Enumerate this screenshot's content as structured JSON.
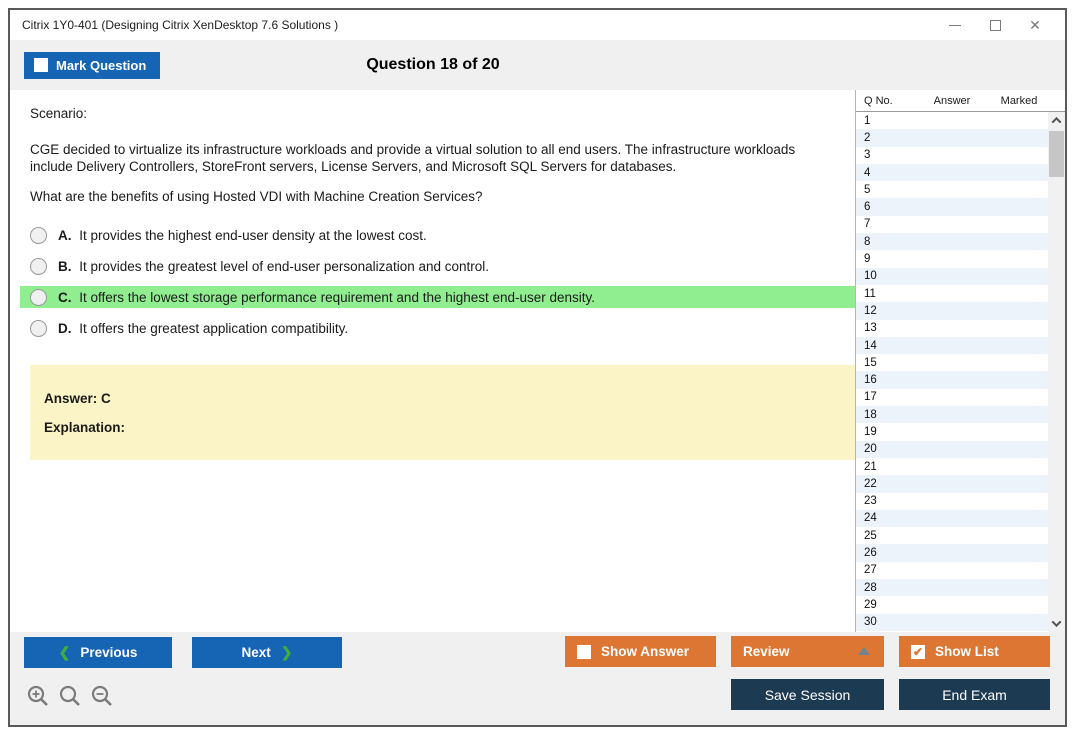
{
  "window": {
    "title": "Citrix 1Y0-401 (Designing Citrix XenDesktop 7.6 Solutions )",
    "close_glyph": "✕"
  },
  "header": {
    "mark_question_label": "Mark Question",
    "question_counter": "Question 18 of 20"
  },
  "question": {
    "scenario_label": "Scenario:",
    "scenario_text": "CGE decided to virtualize its infrastructure workloads and provide a virtual solution to all end users. The infrastructure workloads include Delivery Controllers, StoreFront servers, License Servers, and Microsoft SQL Servers for databases.",
    "prompt": "What are the benefits of using Hosted VDI with Machine Creation Services?",
    "options": [
      {
        "letter": "A.",
        "text": "It provides the highest end-user density at the lowest cost.",
        "highlighted": false
      },
      {
        "letter": "B.",
        "text": "It provides the greatest level of end-user personalization and control.",
        "highlighted": false
      },
      {
        "letter": "C.",
        "text": "It offers the lowest storage performance requirement and the highest end-user density.",
        "highlighted": true
      },
      {
        "letter": "D.",
        "text": "It offers the greatest application compatibility.",
        "highlighted": false
      }
    ],
    "answer_label": "Answer: C",
    "explanation_label": "Explanation:"
  },
  "question_list": {
    "columns": [
      "Q No.",
      "Answer",
      "Marked"
    ],
    "visible_rows": [
      "1",
      "2",
      "3",
      "4",
      "5",
      "6",
      "7",
      "8",
      "9",
      "10",
      "11",
      "12",
      "13",
      "14",
      "15",
      "16",
      "17",
      "18",
      "19",
      "20",
      "21",
      "22",
      "23",
      "24",
      "25",
      "26",
      "27",
      "28",
      "29",
      "30"
    ]
  },
  "footer": {
    "previous_label": "Previous",
    "next_label": "Next",
    "prev_chevron": "❮",
    "next_chevron": "❯",
    "show_answer_label": "Show Answer",
    "review_label": "Review",
    "show_list_label": "Show List",
    "show_list_check": "✔",
    "save_session_label": "Save Session",
    "end_exam_label": "End Exam"
  },
  "colors": {
    "primary_blue": "#1565b4",
    "accent_orange": "#dd7632",
    "dark_navy": "#1c3a52",
    "highlight_green": "#90ee90",
    "answer_yellow": "#faf4c6",
    "alt_row_blue": "#edf3fa",
    "chevron_green": "#3db039"
  }
}
